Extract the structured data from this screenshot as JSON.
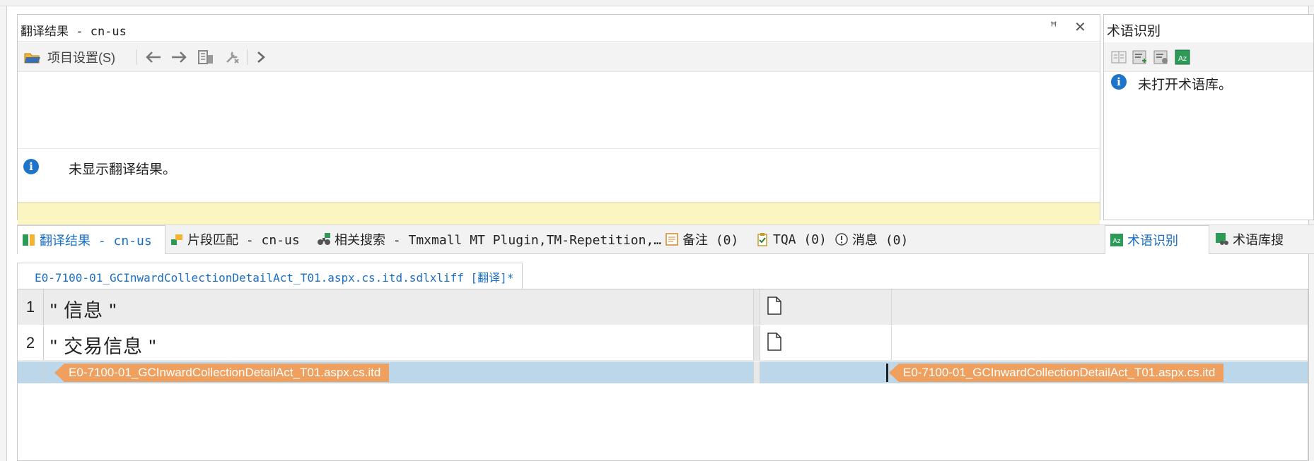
{
  "translation_results": {
    "title": "翻译结果 - cn-us",
    "pin_glyph": "ꟸ",
    "close_glyph": "✕",
    "project_settings_label": "项目设置(S)",
    "info_message": "未显示翻译结果。"
  },
  "terminology": {
    "title": "术语识别",
    "info_message": "未打开术语库。"
  },
  "tabs": [
    {
      "label": "翻译结果 - cn-us"
    },
    {
      "label": "片段匹配 - cn-us"
    },
    {
      "label": "相关搜索 - Tmxmall MT Plugin,TM-Repetition,…"
    },
    {
      "label": "备注 (0)"
    },
    {
      "label": "TQA (0)"
    },
    {
      "label": "消息 (0)"
    },
    {
      "label": "术语识别"
    },
    {
      "label": "术语库搜"
    }
  ],
  "document_tab": {
    "label": "E0-7100-01_GCInwardCollectionDetailAct_T01.aspx.cs.itd.sdlxliff [翻译]*"
  },
  "segments": [
    {
      "num": "1",
      "source": "\" 信息 \""
    },
    {
      "num": "2",
      "source": "\" 交易信息 \""
    }
  ],
  "file_tag": "E0-7100-01_GCInwardCollectionDetailAct_T01.aspx.cs.itd",
  "colors": {
    "accent": "#1a6fc4",
    "yellow_band": "#fbf5c2",
    "tag_orange": "#f0a05e",
    "selected_row": "#bcd7ea"
  }
}
